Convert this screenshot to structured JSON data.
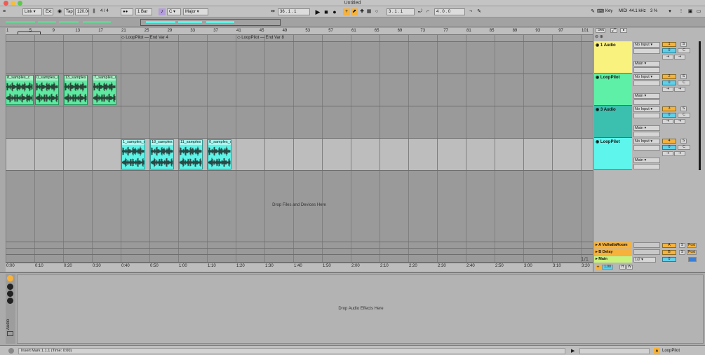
{
  "window": {
    "title": "Untitled"
  },
  "control_bar": {
    "link": "Link",
    "ext": "Ext",
    "tap": "Tap",
    "tempo": "120.00",
    "sig_num": "4",
    "sig_den": "4",
    "quantize": "1 Bar",
    "key_root": "C",
    "scale": "Major",
    "pos_bar": "36",
    "pos_beat": "1",
    "pos_sixteenth": "1",
    "loop_start_bar": "3",
    "loop_start_beat": "1",
    "loop_start_sixteenth": "1",
    "loop_len_bar": "4",
    "loop_len_beat": "0",
    "loop_len_sixteenth": "0",
    "key_label": "Key",
    "midi_label": "MIDI",
    "sample_rate": "44.1 kHz",
    "cpu": "3 %"
  },
  "ruler": {
    "bars": [
      "1",
      "5",
      "9",
      "13",
      "17",
      "21",
      "25",
      "29",
      "33",
      "37",
      "41",
      "45",
      "49",
      "53",
      "57",
      "61",
      "65",
      "69",
      "73",
      "77",
      "81",
      "85",
      "89",
      "93",
      "97",
      "101"
    ]
  },
  "locators": [
    "LoopPilot — End Var 4",
    "LoopPilot — End Var 8"
  ],
  "tracks": [
    {
      "name": "1 Audio",
      "color": "#f9f27f",
      "input": "No Input",
      "output": "Main",
      "number": "1",
      "volume": "0",
      "pan": "C",
      "clips": []
    },
    {
      "name": "LoopPilot",
      "color": "#5ef0a6",
      "input": "No Input",
      "output": "Main",
      "number": "2",
      "volume": "0",
      "pan": "C",
      "clips": [
        {
          "name": "8_samples_c"
        },
        {
          "name": "0_samples_c"
        },
        {
          "name": "13_samples"
        },
        {
          "name": "7_samples_c"
        }
      ]
    },
    {
      "name": "3 Audio",
      "color": "#3bbfae",
      "input": "No Input",
      "output": "Main",
      "number": "3",
      "volume": "0",
      "pan": "C",
      "clips": []
    },
    {
      "name": "LoopPilot",
      "color": "#5ef6ec",
      "input": "No Input",
      "output": "Main",
      "number": "4",
      "volume": "0",
      "pan": "C",
      "clips": [
        {
          "name": "1_samples_c"
        },
        {
          "name": "18_samples"
        },
        {
          "name": "11_samples"
        },
        {
          "name": "0_samples_c"
        }
      ]
    }
  ],
  "drop_files": "Drop Files and Devices Here",
  "page_indicator": "1/1",
  "returns": [
    {
      "name": "A ValhallaRoom",
      "letter": "A",
      "solo": "S",
      "post": "Post"
    },
    {
      "name": "B Delay",
      "letter": "B",
      "solo": "S",
      "post": "Post"
    }
  ],
  "master": {
    "name": "Main",
    "cue": "1/2",
    "volume": "0"
  },
  "time_ruler": [
    "0:00",
    "0:10",
    "0:20",
    "0:30",
    "0:40",
    "0:50",
    "1:00",
    "1:10",
    "1:20",
    "1:30",
    "1:40",
    "1:50",
    "2:00",
    "2:10",
    "2:20",
    "2:30",
    "2:40",
    "2:50",
    "3:00",
    "3:10",
    "3:20"
  ],
  "set_label": "Set",
  "side_label": "Audio",
  "drop_effects": "Drop Audio Effects Here",
  "status": {
    "message": "Insert Mark 1.1.1 (Time: 0:00)",
    "track": "LoopPilot"
  },
  "colors": {
    "accent": "#f7b23b",
    "green_clip": "#5ee8a0",
    "cyan_clip": "#5ef3e7"
  }
}
